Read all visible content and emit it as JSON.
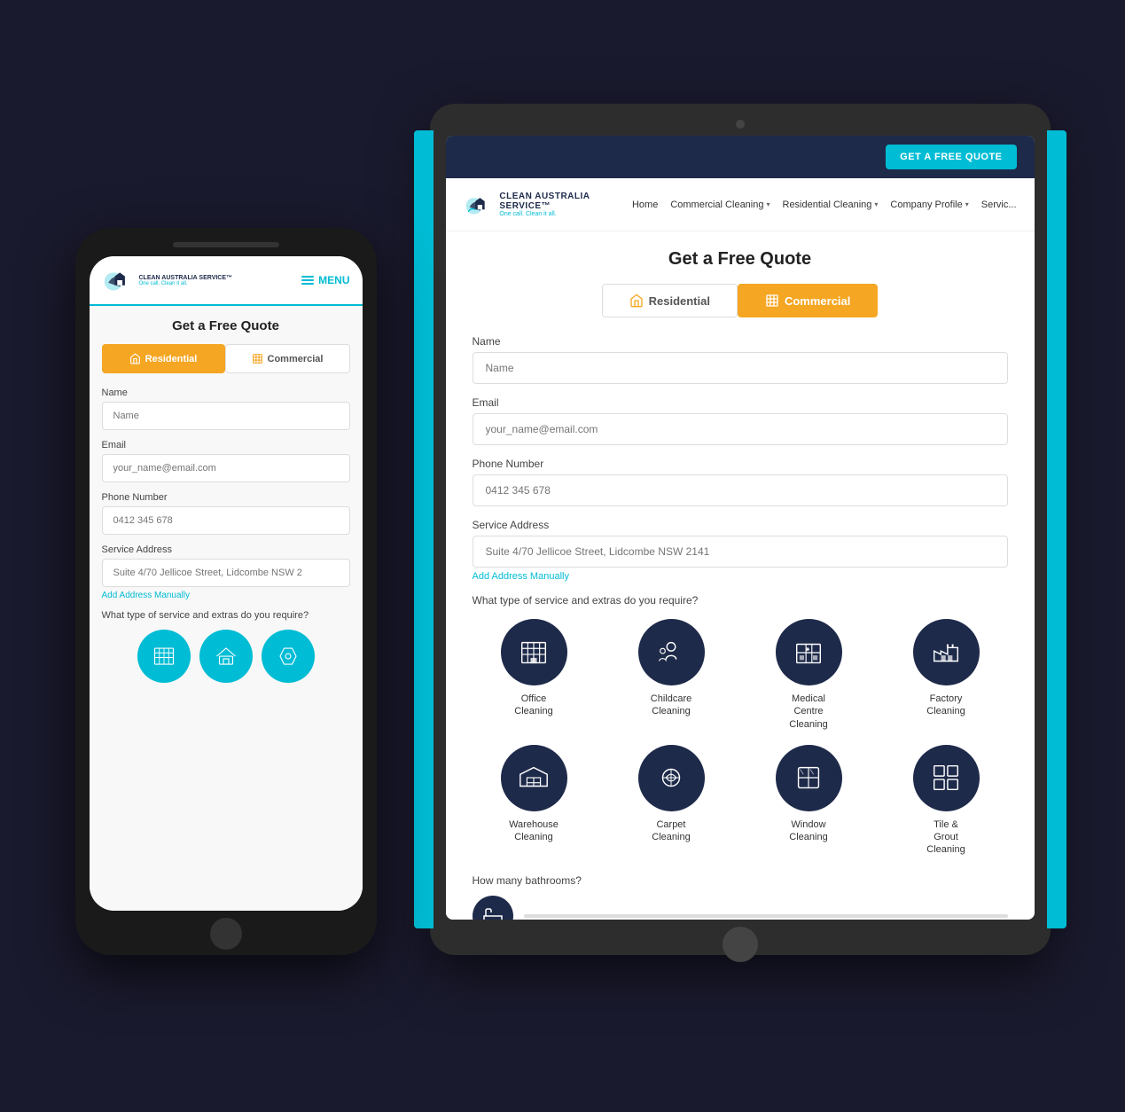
{
  "scene": {
    "background": "#1a1a2e"
  },
  "tablet": {
    "topbar": {
      "get_quote_btn": "GET A FREE QUOTE"
    },
    "nav": {
      "home": "Home",
      "commercial_cleaning": "Commercial Cleaning",
      "residential_cleaning": "Residential Cleaning",
      "company_profile": "Company Profile",
      "services": "Servic..."
    },
    "logo": {
      "main": "CLEAN AUSTRALIA SERVICE™",
      "sub": "One call. Clean it all."
    },
    "form": {
      "title": "Get a Free Quote",
      "tab_residential": "Residential",
      "tab_commercial": "Commercial",
      "name_label": "Name",
      "name_placeholder": "Name",
      "email_label": "Email",
      "email_placeholder": "your_name@email.com",
      "phone_label": "Phone Number",
      "phone_placeholder": "0412 345 678",
      "address_label": "Service Address",
      "address_placeholder": "Suite 4/70 Jellicoe Street, Lidcombe NSW 2141",
      "add_address": "Add Address Manually",
      "service_question": "What type of service and extras do you require?",
      "bathroom_question": "How many bathrooms?"
    },
    "services": [
      {
        "label": "Office\nCleaning",
        "icon": "office"
      },
      {
        "label": "Childcare\nCleaning",
        "icon": "childcare"
      },
      {
        "label": "Medical\nCentre\nCleaning",
        "icon": "medical"
      },
      {
        "label": "Factory\nCleaning",
        "icon": "factory"
      },
      {
        "label": "Warehouse\nCleaning",
        "icon": "warehouse"
      },
      {
        "label": "Carpet\nCleaning",
        "icon": "carpet"
      },
      {
        "label": "Window\nCleaning",
        "icon": "window"
      },
      {
        "label": "Tile &\nGrout\nCleaning",
        "icon": "grout"
      }
    ]
  },
  "phone": {
    "logo": {
      "main": "CLEAN AUSTRALIA SERVICE™",
      "sub": "One call. Clean it all."
    },
    "nav": {
      "menu": "MENU"
    },
    "form": {
      "title": "Get a Free Quote",
      "tab_residential": "Residential",
      "tab_commercial": "Commercial",
      "name_label": "Name",
      "name_placeholder": "Name",
      "email_label": "Email",
      "email_placeholder": "your_name@email.com",
      "phone_label": "Phone Number",
      "phone_placeholder": "0412 345 678",
      "address_label": "Service Address",
      "address_placeholder": "Suite 4/70 Jellicoe Street, Lidcombe NSW 2",
      "add_address": "Add Address Manually",
      "service_question": "What type of service and extras do you require?"
    }
  }
}
